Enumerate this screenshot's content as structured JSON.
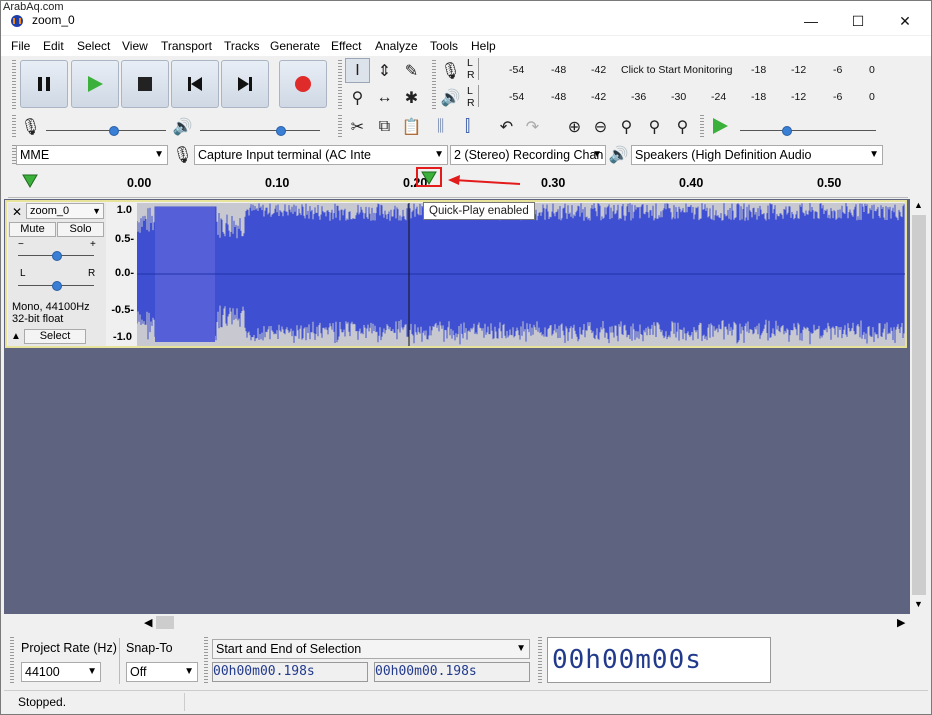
{
  "watermark": "ArabAq.com",
  "window": {
    "title": "zoom_0",
    "minimize": "—",
    "maximize": "☐",
    "close": "✕"
  },
  "menu": [
    "File",
    "Edit",
    "Select",
    "View",
    "Transport",
    "Tracks",
    "Generate",
    "Effect",
    "Analyze",
    "Tools",
    "Help"
  ],
  "meters": {
    "record_scale": [
      "-54",
      "-48",
      "-42",
      "Click to Start Monitoring",
      "-18",
      "-12",
      "-6",
      "0"
    ],
    "play_scale": [
      "-54",
      "-48",
      "-42",
      "-36",
      "-30",
      "-24",
      "-18",
      "-12",
      "-6",
      "0"
    ],
    "lr": [
      "L",
      "R"
    ]
  },
  "device": {
    "host": "MME",
    "input": "Capture Input terminal (AC Inte",
    "channels": "2 (Stereo) Recording Chan",
    "output": "Speakers (High Definition Audio"
  },
  "ruler": {
    "ticks": [
      "0.00",
      "0.10",
      "0.20",
      "0.30",
      "0.40",
      "0.50"
    ],
    "tick_values": [
      0.0,
      0.1,
      0.2,
      0.3,
      0.4,
      0.5
    ]
  },
  "tooltip": "Quick-Play enabled",
  "track": {
    "name": "zoom_0",
    "mute": "Mute",
    "solo": "Solo",
    "gain_minus": "−",
    "gain_plus": "+",
    "pan_l": "L",
    "pan_r": "R",
    "info1": "Mono, 44100Hz",
    "info2": "32-bit float",
    "select": "Select",
    "scale": [
      "1.0",
      "0.5-",
      "0.0-",
      "-0.5-",
      "-1.0"
    ]
  },
  "bottom": {
    "project_rate_label": "Project Rate (Hz)",
    "project_rate": "44100",
    "snap_label": "Snap-To",
    "snap_value": "Off",
    "selection_mode": "Start and End of Selection",
    "sel_start": "00h00m00.198s",
    "sel_end": "00h00m00.198s",
    "audio_position": "00h00m00s"
  },
  "status": "Stopped.",
  "colors": {
    "waveform": "#3f4fd1",
    "waveform_bg": "#7581c4",
    "track_bg": "#5e6380",
    "highlight": "#e31b1b"
  }
}
